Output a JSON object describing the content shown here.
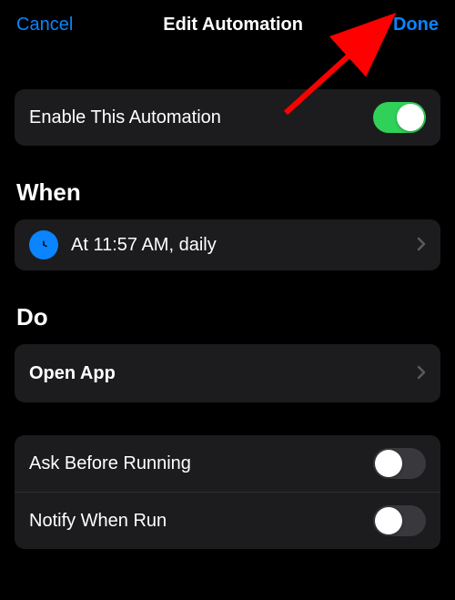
{
  "header": {
    "cancel": "Cancel",
    "title": "Edit Automation",
    "done": "Done"
  },
  "enable": {
    "label": "Enable This Automation",
    "on": true
  },
  "sections": {
    "when": "When",
    "do": "Do"
  },
  "when_row": {
    "label": "At 11:57 AM, daily"
  },
  "do_row": {
    "label": "Open App"
  },
  "options": {
    "ask_before": "Ask Before Running",
    "notify": "Notify When Run"
  },
  "colors": {
    "accent": "#0a84ff",
    "toggle_on": "#30d158"
  }
}
